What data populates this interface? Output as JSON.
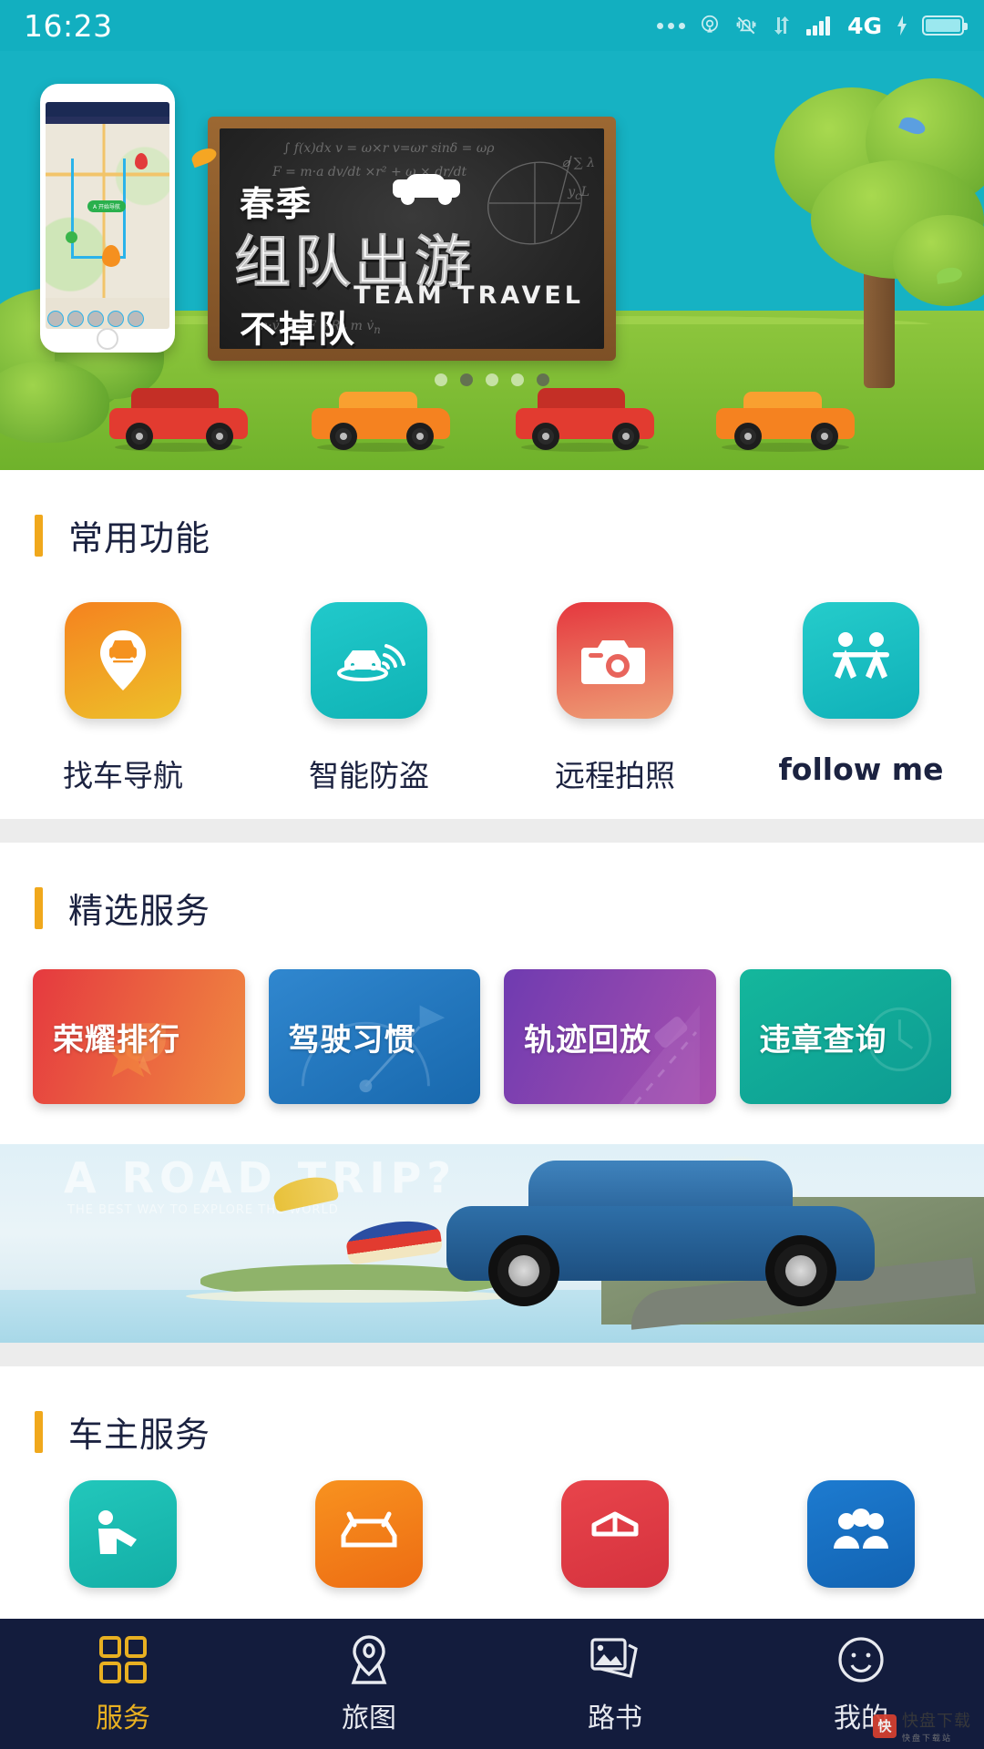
{
  "status_bar": {
    "time": "16:23",
    "network_label": "4G",
    "icons": [
      "more-dots-icon",
      "location-beacon-icon",
      "mute-bell-icon",
      "data-transfer-icon",
      "signal-bars-icon",
      "charging-bolt-icon",
      "battery-icon"
    ]
  },
  "banner": {
    "headline_top": "春季",
    "headline_main": "组队出游",
    "headline_en": "TEAM TRAVEL",
    "headline_sub": "不掉队",
    "dots_count": 5,
    "active_dot_index": 1
  },
  "section_common": {
    "title": "常用功能",
    "accent_color": "#f0a81c",
    "items": [
      {
        "label": "找车导航",
        "icon": "car-pin-icon",
        "color_start": "#f5821f",
        "color_end": "#edc12a"
      },
      {
        "label": "智能防盗",
        "icon": "car-signal-icon",
        "color_start": "#1fc2c8",
        "color_end": "#13b8b5"
      },
      {
        "label": "远程拍照",
        "icon": "camera-icon",
        "color_start": "#e8434a",
        "color_end": "#ec9c72"
      },
      {
        "label": "follow me",
        "icon": "follow-me-people-icon",
        "color_start": "#21c8c8",
        "color_end": "#12b6bc"
      }
    ]
  },
  "section_featured": {
    "title": "精选服务",
    "accent_color": "#f0a81c",
    "cards": [
      {
        "label": "荣耀排行",
        "color_start": "#e5393f",
        "color_end": "#f08b41"
      },
      {
        "label": "驾驶习惯",
        "color_start": "#2a80c8",
        "color_end": "#1a6fb5"
      },
      {
        "label": "轨迹回放",
        "color_start": "#7a3fb0",
        "color_end": "#a24fae"
      },
      {
        "label": "违章查询",
        "color_start": "#12b39a",
        "color_end": "#0f9f94"
      }
    ]
  },
  "promo": {
    "title": "A ROAD TRIP?",
    "subtitle": "THE BEST WAY TO EXPLORE THE WORLD"
  },
  "section_owner": {
    "title": "车主服务",
    "accent_color": "#f0a81c",
    "items": [
      {
        "icon": "rescue-icon",
        "color_start": "#1fc2b8",
        "color_end": "#16b0a8"
      },
      {
        "icon": "maintenance-icon",
        "color_start": "#f5821f",
        "color_end": "#ef6f17"
      },
      {
        "icon": "insurance-icon",
        "color_start": "#e8434a",
        "color_end": "#d93440"
      },
      {
        "icon": "community-icon",
        "color_start": "#1a73c8",
        "color_end": "#1464b5"
      }
    ]
  },
  "bottom_nav": {
    "active_index": 0,
    "active_color": "#e8b021",
    "items": [
      {
        "label": "服务",
        "icon": "grid-squares-icon"
      },
      {
        "label": "旅图",
        "icon": "map-pin-icon"
      },
      {
        "label": "路书",
        "icon": "photos-icon"
      },
      {
        "label": "我的",
        "icon": "smiley-face-icon"
      }
    ]
  },
  "watermark": {
    "logo": "快",
    "name": "快盘下载",
    "sub": "快盘下载站"
  }
}
